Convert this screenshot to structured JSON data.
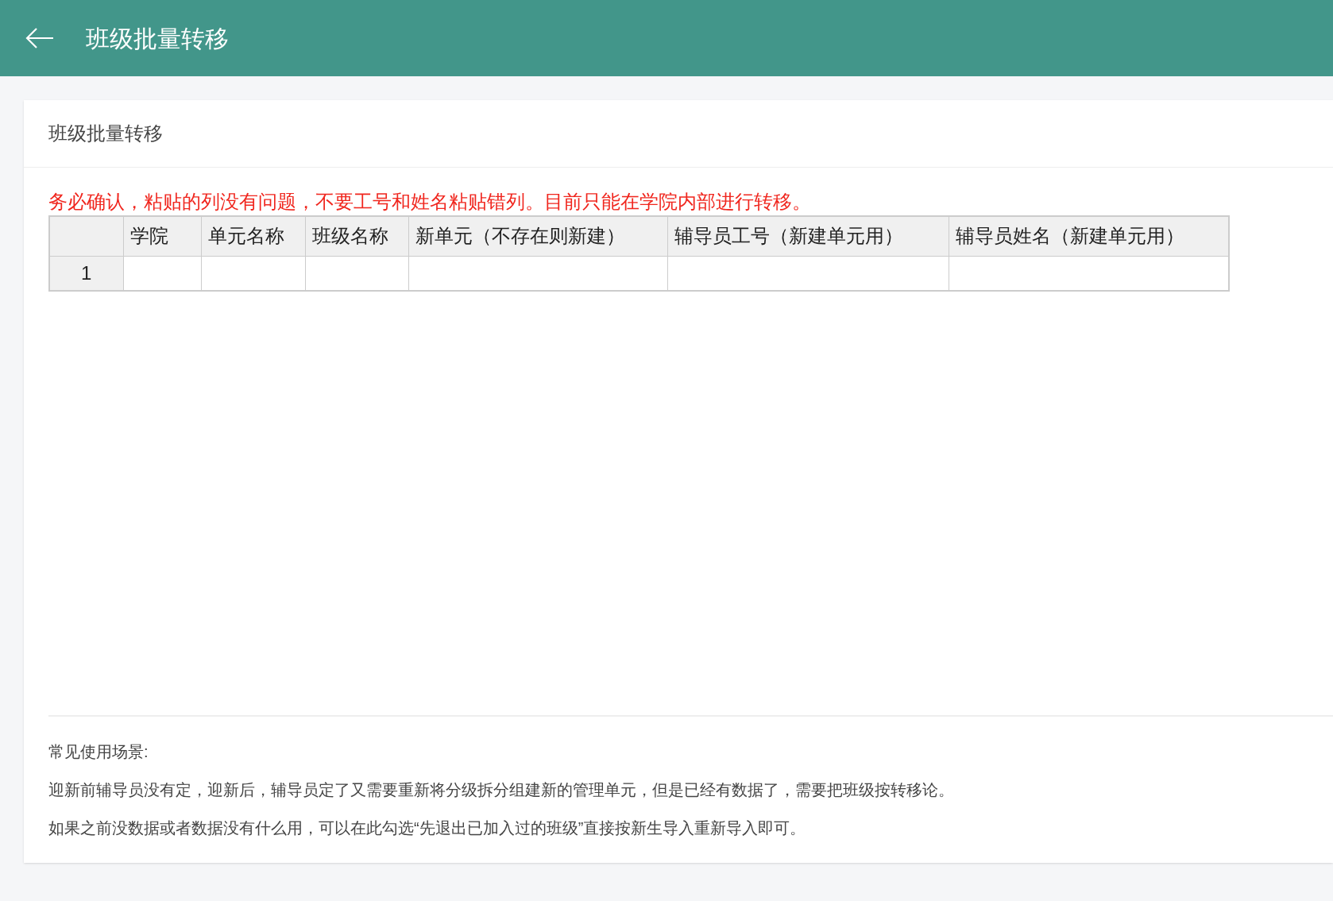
{
  "header": {
    "title": "班级批量转移"
  },
  "card": {
    "title": "班级批量转移"
  },
  "warning": "务必确认，粘贴的列没有问题，不要工号和姓名粘贴错列。目前只能在学院内部进行转移。",
  "table": {
    "columns": [
      "学院",
      "单元名称",
      "班级名称",
      "新单元（不存在则新建）",
      "辅导员工号（新建单元用）",
      "辅导员姓名（新建单元用）"
    ],
    "rows": [
      {
        "number": "1"
      }
    ]
  },
  "notes": [
    "常见使用场景:",
    "迎新前辅导员没有定，迎新后，辅导员定了又需要重新将分级拆分组建新的管理单元，但是已经有数据了，需要把班级按转移论。",
    "如果之前没数据或者数据没有什么用，可以在此勾选“先退出已加入过的班级”直接按新生导入重新导入即可。"
  ]
}
